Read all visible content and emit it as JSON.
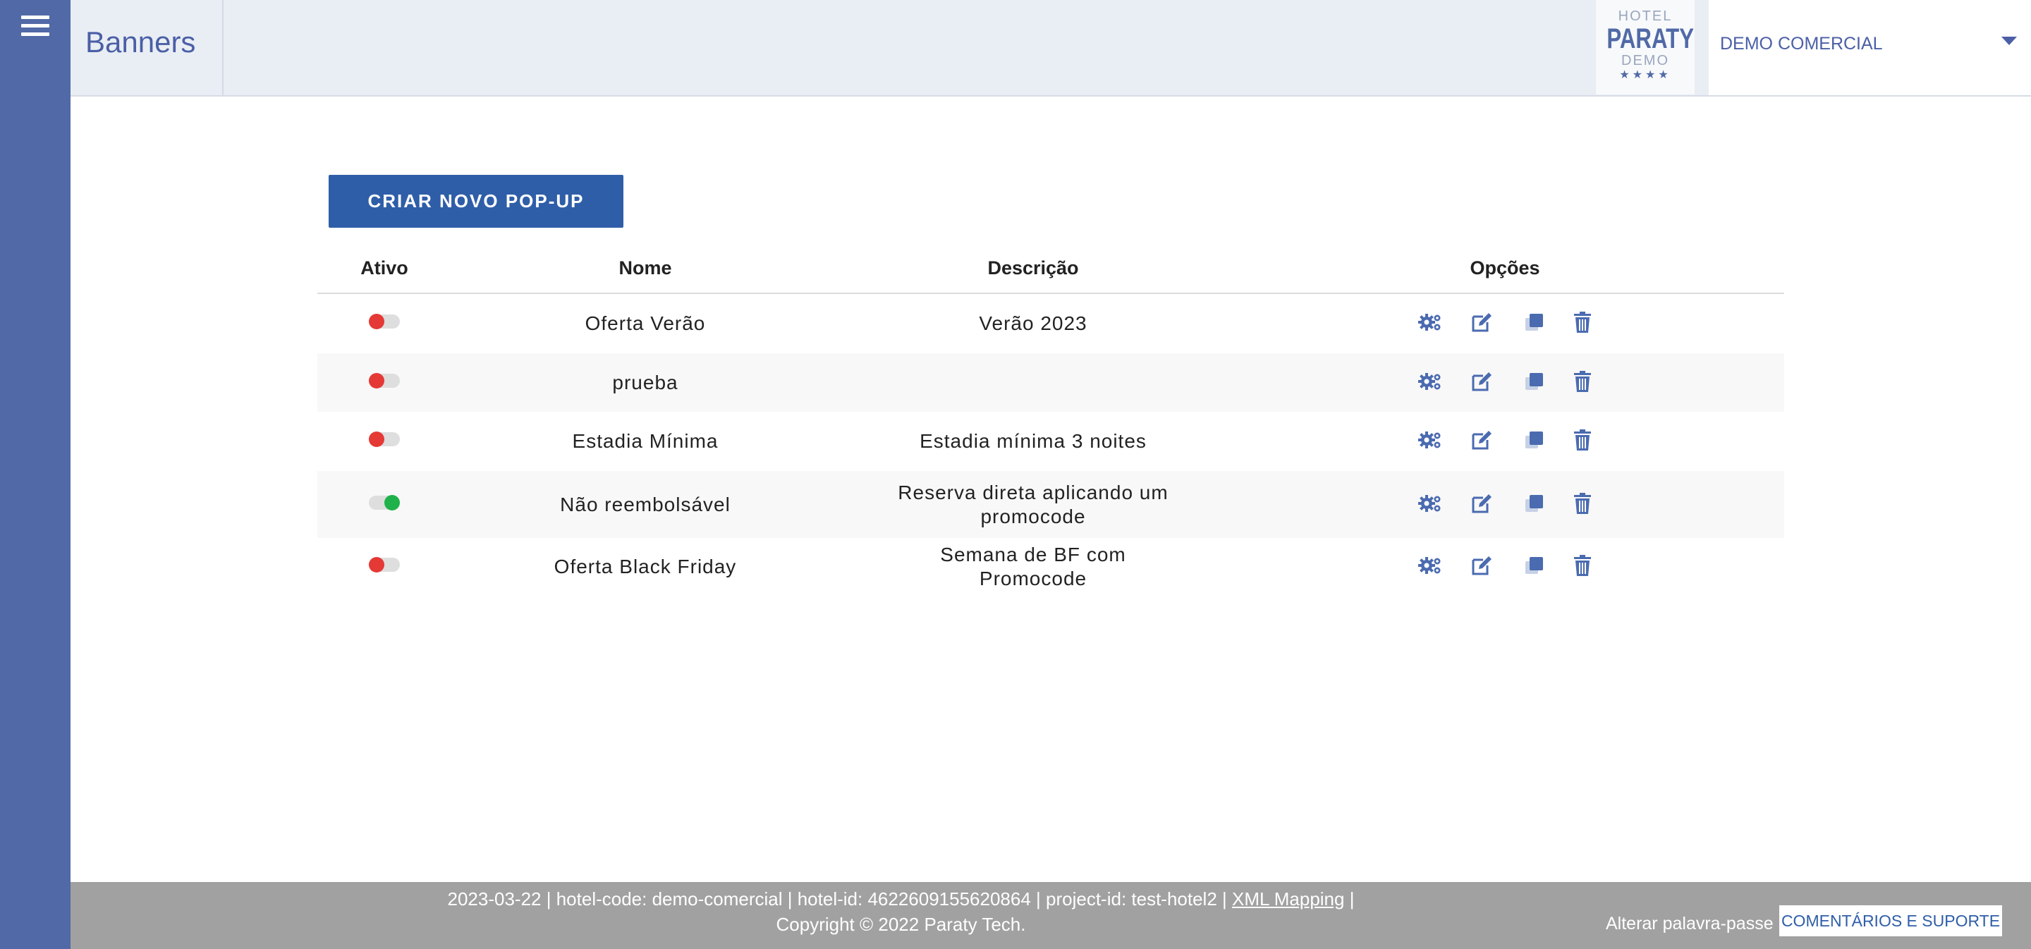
{
  "header": {
    "title": "Banners",
    "logo": {
      "top": "HOTEL",
      "brand": "PARATY",
      "sub": "DEMO",
      "stars": "★★★★"
    },
    "hotel_select": "DEMO COMERCIAL"
  },
  "toolbar": {
    "create_label": "CRIAR NOVO POP-UP"
  },
  "table": {
    "headers": {
      "active": "Ativo",
      "name": "Nome",
      "description": "Descrição",
      "options": "Opções"
    },
    "rows": [
      {
        "active": false,
        "name": "Oferta Verão",
        "description": "Verão 2023"
      },
      {
        "active": false,
        "name": "prueba",
        "description": ""
      },
      {
        "active": false,
        "name": "Estadia Mínima",
        "description": "Estadia mínima 3 noites"
      },
      {
        "active": true,
        "name": "Não reembolsável",
        "description": "Reserva direta aplicando um promocode"
      },
      {
        "active": false,
        "name": "Oferta Black Friday",
        "description": "Semana de BF com Promocode"
      }
    ]
  },
  "footer": {
    "info": "2023-03-22 | hotel-code: demo-comercial | hotel-id: 4622609155620864 | project-id: test-hotel2 |",
    "xml_link": "XML Mapping",
    "sep": "|",
    "copyright": "Copyright © 2022 Paraty Tech.",
    "change_password": "Alterar palavra-passe",
    "support": "COMENTÁRIOS E SUPORTE"
  },
  "colors": {
    "sidebar": "#5169a6",
    "primary": "#2f5ea8",
    "off": "#e53935",
    "on": "#20b24a",
    "icon": "#4b6bb0"
  },
  "icons": [
    "gear-icon",
    "edit-icon",
    "copy-icon",
    "trash-icon"
  ]
}
